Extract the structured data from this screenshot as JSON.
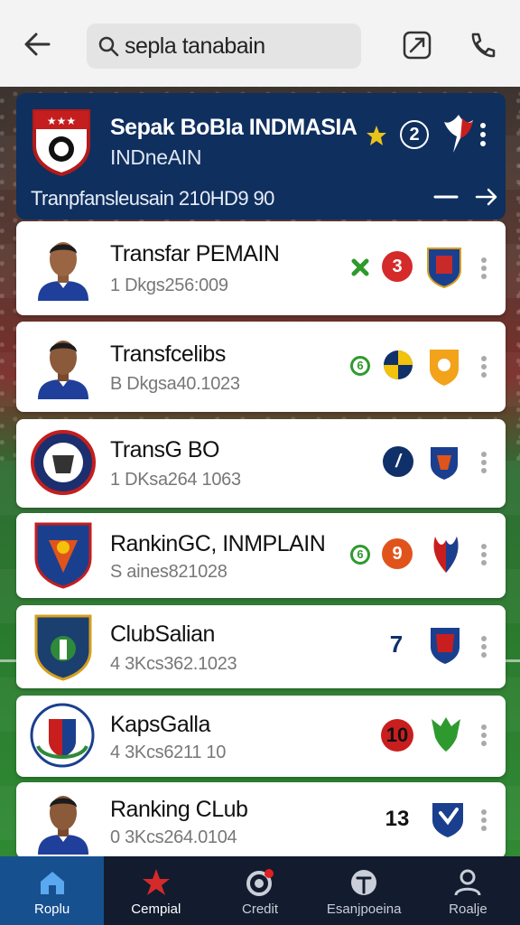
{
  "search": {
    "value": "sepla tanabain"
  },
  "hero": {
    "title": "Sepak BoBla INDMASIA",
    "subtitle": "INDneAIN",
    "description": "Tranpfansleusain 210HD9 90",
    "rank": "2"
  },
  "items": [
    {
      "name": "Transfar PEMAIN",
      "meta": "1 Dkgs256:009",
      "rank": "3",
      "rank_color": "#d42a2a",
      "small": "",
      "small_color": "#2e9a2e"
    },
    {
      "name": "Transfcelibs",
      "meta": "B Dkgsa40.1023",
      "rank": "",
      "rank_color": "#f2c20c",
      "small": "6",
      "small_color": "#2e9a2e"
    },
    {
      "name": "TransG BO",
      "meta": "1 DKsa264 1063",
      "rank": "/",
      "rank_color": "#10306a",
      "small": "",
      "small_color": ""
    },
    {
      "name": "RankinGC, INMPLAIN",
      "meta": "S aines821028",
      "rank": "9",
      "rank_color": "#e0541c",
      "small": "6",
      "small_color": "#2e9a2e"
    },
    {
      "name": "ClubSalian",
      "meta": "4 3Kcs362.1023",
      "rank": "7",
      "rank_color": "",
      "small": "",
      "small_color": ""
    },
    {
      "name": "KapsGalla",
      "meta": "4 3Kcs6211 10",
      "rank": "10",
      "rank_color": "#c91e1e",
      "small": "",
      "small_color": ""
    },
    {
      "name": "Ranking CLub",
      "meta": "0 3Kcs264.0104",
      "rank": "13",
      "rank_color": "",
      "small": "",
      "small_color": ""
    }
  ],
  "nav": [
    {
      "label": "Roplu"
    },
    {
      "label": "Cempial"
    },
    {
      "label": "Credit"
    },
    {
      "label": "Esanjpoeina"
    },
    {
      "label": "Roalje"
    }
  ],
  "colors": {
    "navy": "#0f2f5e",
    "nav_active": "#17508f",
    "nav_bg": "#121c2e"
  }
}
